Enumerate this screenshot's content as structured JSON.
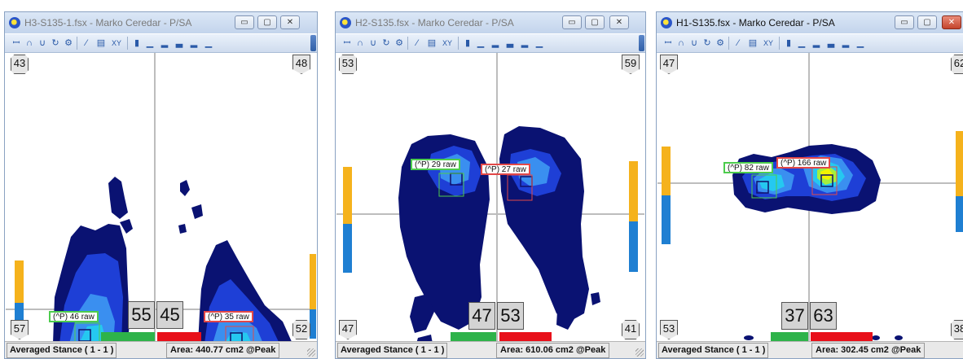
{
  "colors": {
    "low": "#0a1272",
    "mid": "#1e3fd6",
    "light": "#3a8ff0",
    "cyan": "#25c8f0",
    "green_peak": "#a6ee3c",
    "yellow_peak": "#f2f200",
    "left_bar_top": "#f5b21c",
    "left_bar_bottom": "#1f7fd2",
    "green_bar": "#2eb34a",
    "red_bar": "#e8101a"
  },
  "windows": [
    {
      "title": "H3-S135-1.fsx - Marko  Ceredar - P/SA",
      "active": false,
      "corners": {
        "tl": "43",
        "tr": "48",
        "bl": "57",
        "br": "52"
      },
      "peaks": {
        "left": "(^P) 46 raw",
        "right": "(^P) 35 raw"
      },
      "totals": {
        "left": "55",
        "right": "45"
      },
      "status_left": "Averaged Stance ( 1 - 1 )",
      "status_right": "Area: 440.77 cm2 @Peak"
    },
    {
      "title": "H2-S135.fsx - Marko  Ceredar - P/SA",
      "active": false,
      "corners": {
        "tl": "53",
        "tr": "59",
        "bl": "47",
        "br": "41"
      },
      "peaks": {
        "left": "(^P) 29 raw",
        "right": "(^P) 27 raw"
      },
      "totals": {
        "left": "47",
        "right": "53"
      },
      "status_left": "Averaged Stance ( 1 - 1 )",
      "status_right": "Area: 610.06 cm2 @Peak"
    },
    {
      "title": "H1-S135.fsx - Marko  Ceredar - P/SA",
      "active": true,
      "corners": {
        "tl": "47",
        "tr": "62",
        "bl": "53",
        "br": "38"
      },
      "peaks": {
        "left": "(^P) 82 raw",
        "right": "(^P) 166 raw"
      },
      "totals": {
        "left": "37",
        "right": "63"
      },
      "status_left": "Averaged Stance ( 1 - 1 )",
      "status_right": "Area: 302.45 cm2 @Peak"
    }
  ],
  "titlebar_buttons": {
    "minimize": "▭",
    "maximize": "▢",
    "close": "✕"
  },
  "toolbar": {
    "xy_label": "XY"
  }
}
